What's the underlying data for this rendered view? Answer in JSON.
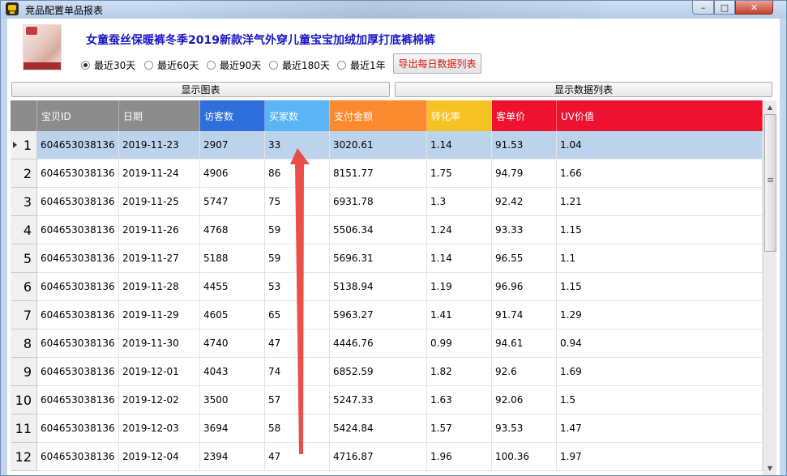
{
  "window": {
    "title": "竞品配置单品报表"
  },
  "product": {
    "title": "女童蚕丝保暖裤冬季2019新款洋气外穿儿童宝宝加绒加厚打底裤棉裤"
  },
  "range": {
    "options": [
      "最近30天",
      "最近60天",
      "最近90天",
      "最近180天",
      "最近1年"
    ],
    "selected_index": 0
  },
  "buttons": {
    "export": "导出每日数据列表",
    "show_chart": "显示图表",
    "show_list": "显示数据列表"
  },
  "table": {
    "columns": [
      {
        "label": "宝贝ID",
        "color": "#8c8c8c"
      },
      {
        "label": "日期",
        "color": "#8c8c8c"
      },
      {
        "label": "访客数",
        "color": "#2f6fdc"
      },
      {
        "label": "买家数",
        "color": "#5ab4f5"
      },
      {
        "label": "支付金额",
        "color": "#fb8a2e"
      },
      {
        "label": "转化率",
        "color": "#f6c223"
      },
      {
        "label": "客单价",
        "color": "#ee1230"
      },
      {
        "label": "UV价值",
        "color": "#ee1230"
      }
    ],
    "rows": [
      {
        "n": "1",
        "id": "604653038136",
        "date": "2019-11-23",
        "visitors": "2907",
        "buyers": "33",
        "amount": "3020.61",
        "conv": "1.14",
        "price": "91.53",
        "uv": "1.04"
      },
      {
        "n": "2",
        "id": "604653038136",
        "date": "2019-11-24",
        "visitors": "4906",
        "buyers": "86",
        "amount": "8151.77",
        "conv": "1.75",
        "price": "94.79",
        "uv": "1.66"
      },
      {
        "n": "3",
        "id": "604653038136",
        "date": "2019-11-25",
        "visitors": "5747",
        "buyers": "75",
        "amount": "6931.78",
        "conv": "1.3",
        "price": "92.42",
        "uv": "1.21"
      },
      {
        "n": "4",
        "id": "604653038136",
        "date": "2019-11-26",
        "visitors": "4768",
        "buyers": "59",
        "amount": "5506.34",
        "conv": "1.24",
        "price": "93.33",
        "uv": "1.15"
      },
      {
        "n": "5",
        "id": "604653038136",
        "date": "2019-11-27",
        "visitors": "5188",
        "buyers": "59",
        "amount": "5696.31",
        "conv": "1.14",
        "price": "96.55",
        "uv": "1.1"
      },
      {
        "n": "6",
        "id": "604653038136",
        "date": "2019-11-28",
        "visitors": "4455",
        "buyers": "53",
        "amount": "5138.94",
        "conv": "1.19",
        "price": "96.96",
        "uv": "1.15"
      },
      {
        "n": "7",
        "id": "604653038136",
        "date": "2019-11-29",
        "visitors": "4605",
        "buyers": "65",
        "amount": "5963.27",
        "conv": "1.41",
        "price": "91.74",
        "uv": "1.29"
      },
      {
        "n": "8",
        "id": "604653038136",
        "date": "2019-11-30",
        "visitors": "4740",
        "buyers": "47",
        "amount": "4446.76",
        "conv": "0.99",
        "price": "94.61",
        "uv": "0.94"
      },
      {
        "n": "9",
        "id": "604653038136",
        "date": "2019-12-01",
        "visitors": "4043",
        "buyers": "74",
        "amount": "6852.59",
        "conv": "1.82",
        "price": "92.6",
        "uv": "1.69"
      },
      {
        "n": "10",
        "id": "604653038136",
        "date": "2019-12-02",
        "visitors": "3500",
        "buyers": "57",
        "amount": "5247.33",
        "conv": "1.63",
        "price": "92.06",
        "uv": "1.5"
      },
      {
        "n": "11",
        "id": "604653038136",
        "date": "2019-12-03",
        "visitors": "3694",
        "buyers": "58",
        "amount": "5424.84",
        "conv": "1.57",
        "price": "93.53",
        "uv": "1.47"
      },
      {
        "n": "12",
        "id": "604653038136",
        "date": "2019-12-04",
        "visitors": "2394",
        "buyers": "47",
        "amount": "4716.87",
        "conv": "1.96",
        "price": "100.36",
        "uv": "1.97"
      }
    ],
    "selected_row": 0
  }
}
